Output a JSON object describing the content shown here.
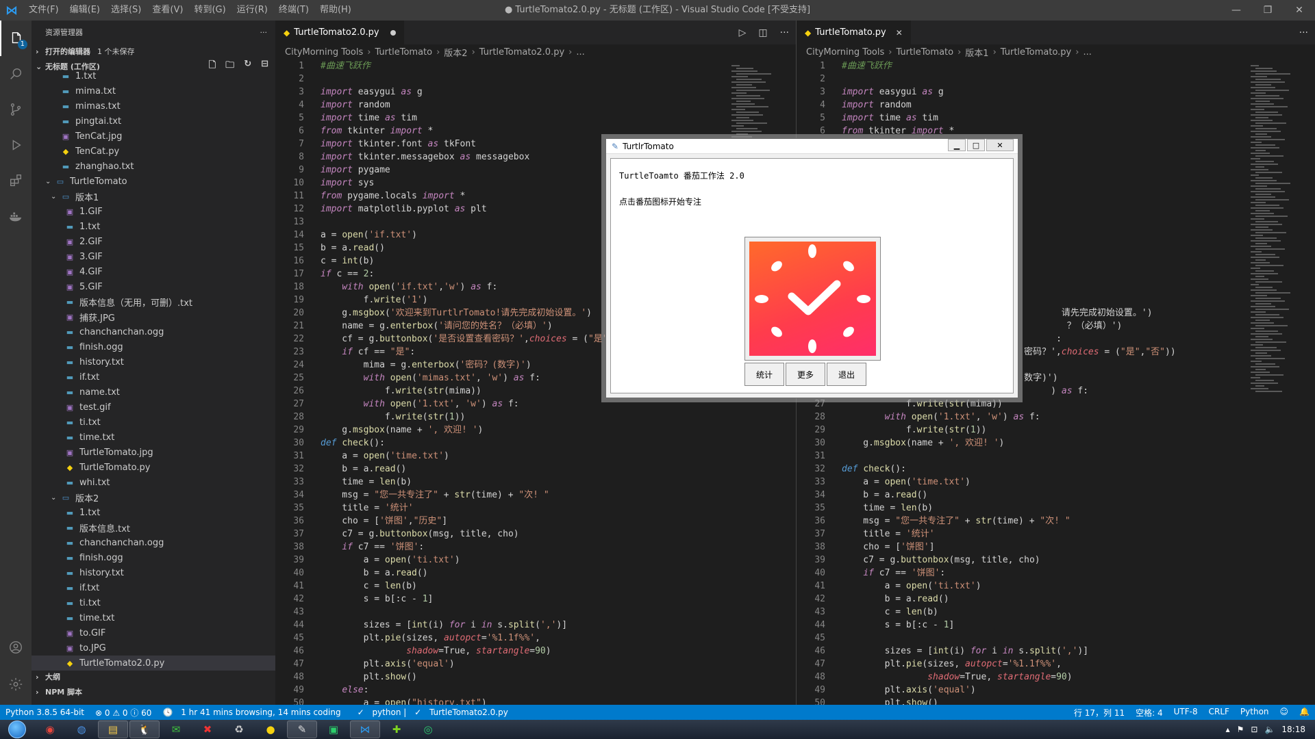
{
  "titlebar": {
    "menu": [
      "文件(F)",
      "编辑(E)",
      "选择(S)",
      "查看(V)",
      "转到(G)",
      "运行(R)",
      "终端(T)",
      "帮助(H)"
    ],
    "title": "● TurtleTomato2.0.py - 无标题 (工作区) - Visual Studio Code [不受支持]"
  },
  "activity": {
    "explorer_badge": "1"
  },
  "sidebar": {
    "header": "资源管理器",
    "open_editors": "打开的编辑器",
    "unsaved": "1 个未保存",
    "workspace": "无标题 (工作区)",
    "top_files": [
      {
        "name": "1.txt",
        "kind": "txt"
      },
      {
        "name": "mima.txt",
        "kind": "txt"
      },
      {
        "name": "mimas.txt",
        "kind": "txt"
      },
      {
        "name": "pingtai.txt",
        "kind": "txt"
      },
      {
        "name": "TenCat.jpg",
        "kind": "img"
      },
      {
        "name": "TenCat.py",
        "kind": "py"
      },
      {
        "name": "zhanghao.txt",
        "kind": "txt"
      }
    ],
    "folder_main": "TurtleTomato",
    "folder_v1": "版本1",
    "v1_files": [
      {
        "name": "1.GIF",
        "kind": "img"
      },
      {
        "name": "1.txt",
        "kind": "txt"
      },
      {
        "name": "2.GIF",
        "kind": "img"
      },
      {
        "name": "3.GIF",
        "kind": "img"
      },
      {
        "name": "4.GIF",
        "kind": "img"
      },
      {
        "name": "5.GIF",
        "kind": "img"
      },
      {
        "name": "版本信息（无用，可删）.txt",
        "kind": "txt"
      },
      {
        "name": "捕获.JPG",
        "kind": "img"
      },
      {
        "name": "chanchanchan.ogg",
        "kind": "ogg"
      },
      {
        "name": "finish.ogg",
        "kind": "ogg"
      },
      {
        "name": "history.txt",
        "kind": "txt"
      },
      {
        "name": "if.txt",
        "kind": "txt"
      },
      {
        "name": "name.txt",
        "kind": "txt"
      },
      {
        "name": "test.gif",
        "kind": "img"
      },
      {
        "name": "ti.txt",
        "kind": "txt"
      },
      {
        "name": "time.txt",
        "kind": "txt"
      },
      {
        "name": "TurtleTomato.jpg",
        "kind": "img"
      },
      {
        "name": "TurtleTomato.py",
        "kind": "py"
      },
      {
        "name": "whi.txt",
        "kind": "txt"
      }
    ],
    "folder_v2": "版本2",
    "v2_files": [
      {
        "name": "1.txt",
        "kind": "txt"
      },
      {
        "name": "版本信息.txt",
        "kind": "txt"
      },
      {
        "name": "chanchanchan.ogg",
        "kind": "ogg"
      },
      {
        "name": "finish.ogg",
        "kind": "ogg"
      },
      {
        "name": "history.txt",
        "kind": "txt"
      },
      {
        "name": "if.txt",
        "kind": "txt"
      },
      {
        "name": "ti.txt",
        "kind": "txt"
      },
      {
        "name": "time.txt",
        "kind": "txt"
      },
      {
        "name": "to.GIF",
        "kind": "img"
      },
      {
        "name": "to.JPG",
        "kind": "img"
      },
      {
        "name": "TurtleTomato2.0.py",
        "kind": "py"
      }
    ],
    "outline": "大纲",
    "npm": "NPM 脚本"
  },
  "editor_left": {
    "tab": "TurtleTomato2.0.py",
    "breadcrumb": [
      "CityMorning Tools",
      "TurtleTomato",
      "版本2",
      "TurtleTomato2.0.py",
      "..."
    ],
    "start_line": 1
  },
  "editor_right": {
    "tab": "TurtleTomato.py",
    "breadcrumb": [
      "CityMorning Tools",
      "TurtleTomato",
      "版本1",
      "TurtleTomato.py",
      "..."
    ]
  },
  "dialog": {
    "title": "TurtlrTomato",
    "line1": "TurtleToamto  番茄工作法 2.0",
    "line2": "点击番茄图标开始专注",
    "buttons": [
      "统计",
      "更多",
      "退出"
    ]
  },
  "status": {
    "python": "Python 3.8.5 64-bit",
    "problems": "⊗ 0 ⚠ 0 ⓘ 60",
    "time": "1 hr 41 mins browsing, 14 mins coding",
    "lang_left": "python |",
    "file": "TurtleTomato2.0.py",
    "position": "行 17，列 11",
    "spaces": "空格: 4",
    "encoding": "UTF-8",
    "eol": "CRLF",
    "language": "Python"
  },
  "taskbar": {
    "clock": "18:18"
  },
  "colors": {
    "accent": "#007acc",
    "tomato": "#ff4a3c"
  }
}
